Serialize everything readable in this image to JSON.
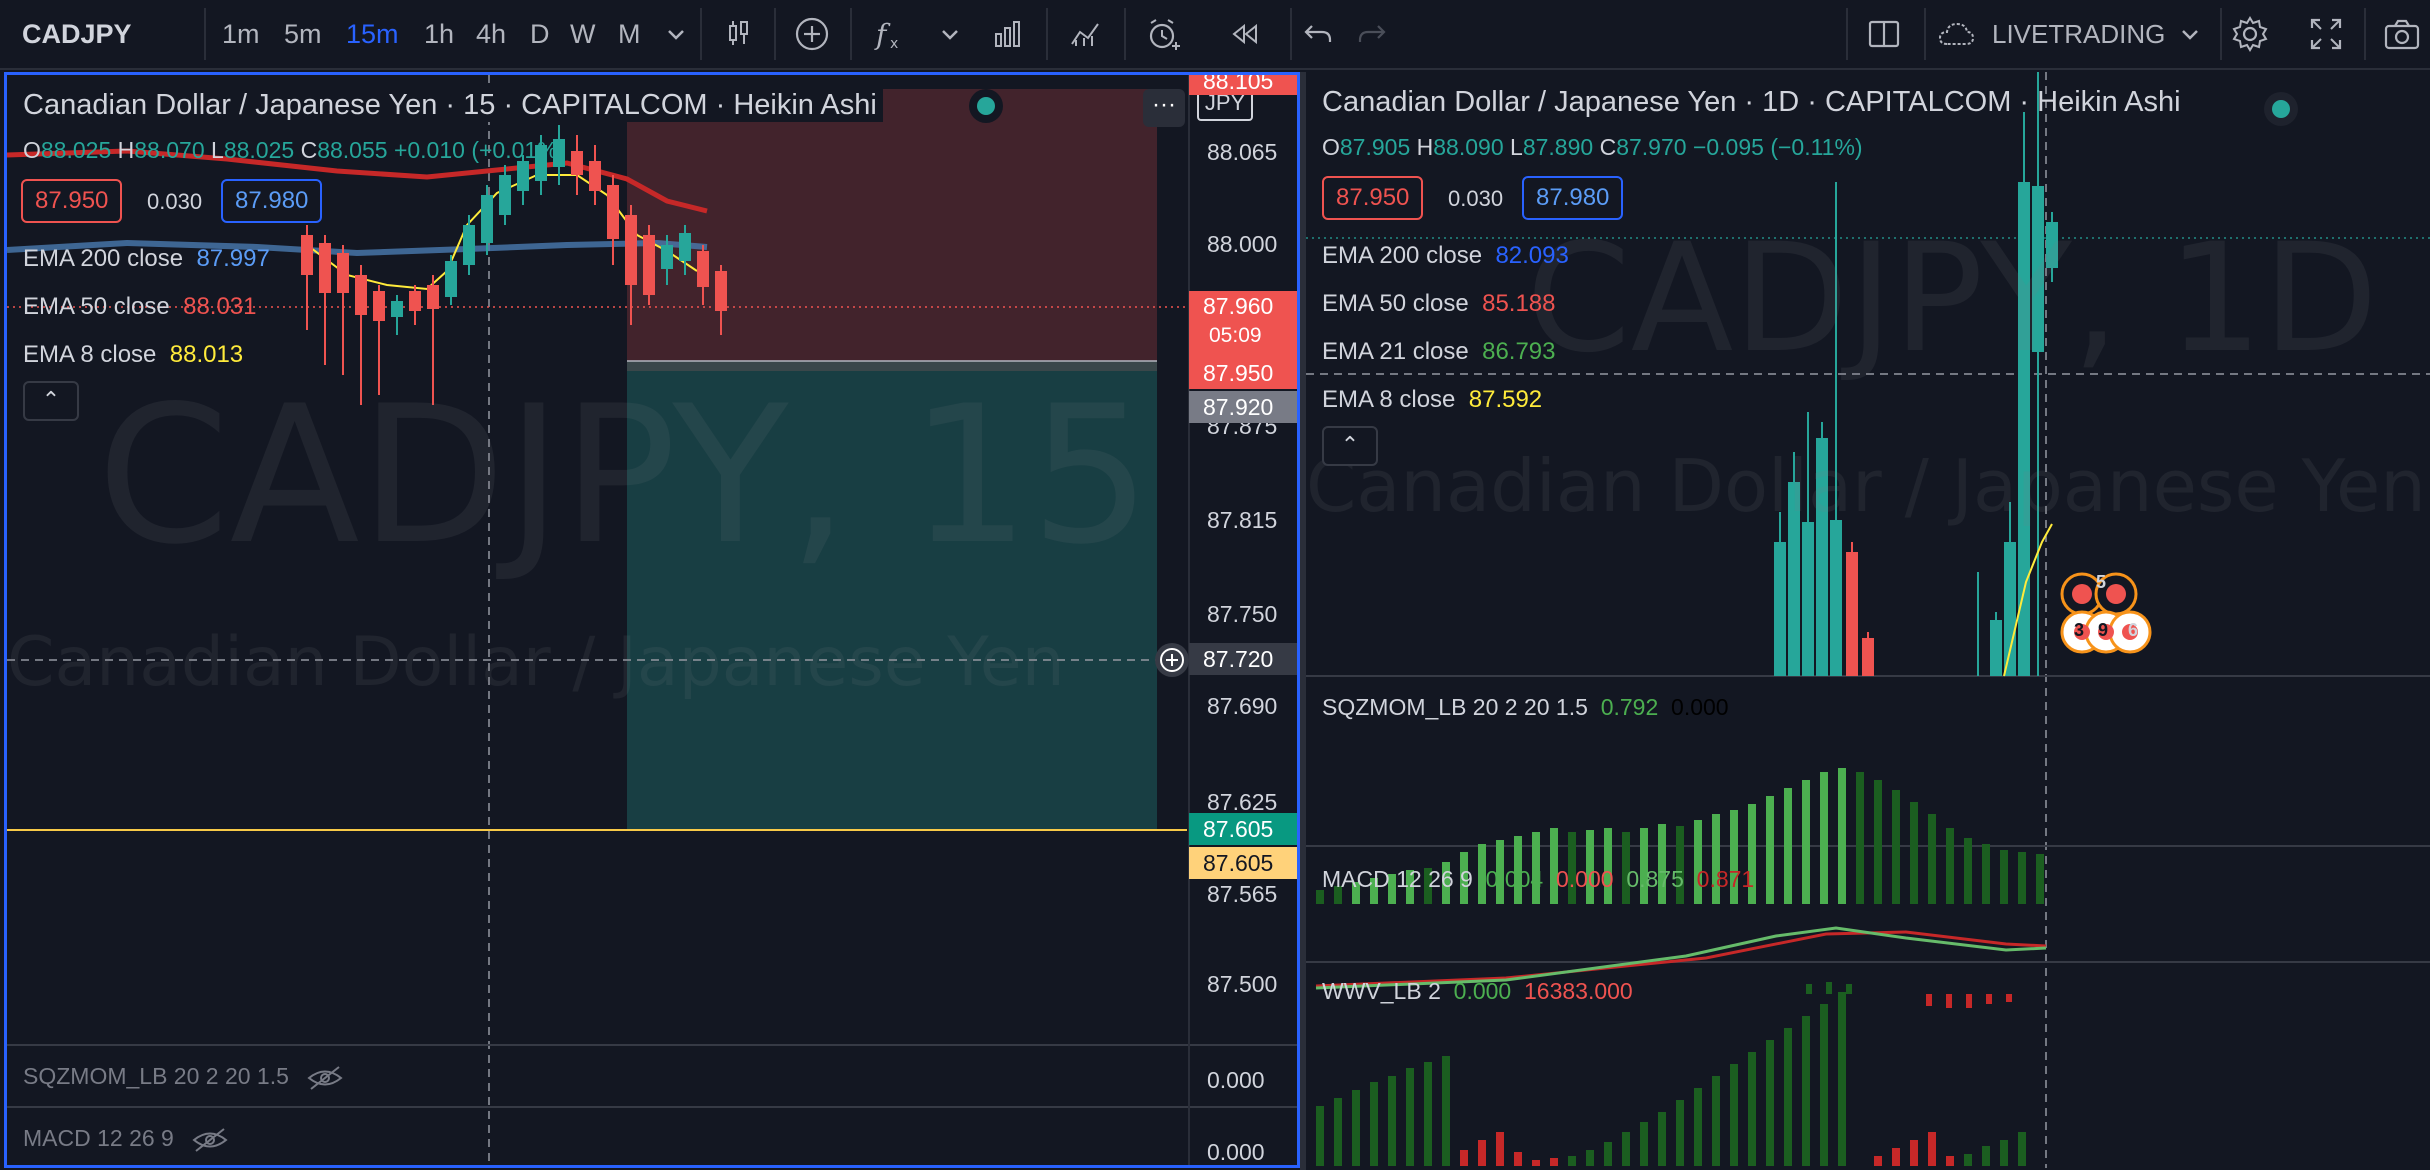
{
  "toolbar": {
    "symbol": "CADJPY",
    "intervals": [
      "1m",
      "5m",
      "15m",
      "1h",
      "4h",
      "D",
      "W",
      "M"
    ],
    "active_interval": "15m",
    "livetrading_label": "LIVETRADING"
  },
  "left_chart": {
    "title": "Canadian Dollar / Japanese Yen · 15 · CAPITALCOM · Heikin Ashi",
    "ohlc": {
      "o_label": "O",
      "o": "88.025",
      "h_label": "H",
      "h": "88.070",
      "l_label": "L",
      "l": "88.025",
      "c_label": "C",
      "c": "88.055",
      "change": "+0.010 (+0.01%)"
    },
    "sell_price": "87.950",
    "spread": "0.030",
    "buy_price": "87.980",
    "indicators": [
      {
        "label": "EMA 200 close",
        "value": "87.997",
        "color": "#5b9cf6"
      },
      {
        "label": "EMA 50 close",
        "value": "88.031",
        "color": "#ef5350"
      },
      {
        "label": "EMA 8 close",
        "value": "88.013",
        "color": "#ffeb3b"
      }
    ],
    "watermark_big": "CADJPY, 15",
    "watermark_small": "Canadian Dollar / Japanese Yen",
    "currency_badge": "JPY",
    "more_label": "···",
    "collapse_label": "⌃",
    "axis_ticks": [
      "88.105",
      "88.065",
      "88.000",
      "87.875",
      "87.815",
      "87.750",
      "87.690",
      "87.625",
      "87.565",
      "87.500"
    ],
    "axis_tags": {
      "last_price": "87.960",
      "countdown": "05:09",
      "sell": "87.950",
      "gray": "87.920",
      "crosshair": "87.720",
      "green": "87.605",
      "yellow": "87.605"
    },
    "sub1": {
      "label": "SQZMOM_LB 20 2 20 1.5",
      "axis": "0.000"
    },
    "sub2": {
      "label": "MACD 12 26 9",
      "axis": "0.000"
    }
  },
  "right_chart": {
    "title": "Canadian Dollar / Japanese Yen · 1D · CAPITALCOM · Heikin Ashi",
    "ohlc": {
      "o_label": "O",
      "o": "87.905",
      "h_label": "H",
      "h": "88.090",
      "l_label": "L",
      "l": "87.890",
      "c_label": "C",
      "c": "87.970",
      "change": "−0.095 (−0.11%)"
    },
    "sell_price": "87.950",
    "spread": "0.030",
    "buy_price": "87.980",
    "indicators": [
      {
        "label": "EMA 200 close",
        "value": "82.093",
        "color": "#2962ff"
      },
      {
        "label": "EMA 50 close",
        "value": "85.188",
        "color": "#ef5350"
      },
      {
        "label": "EMA 21 close",
        "value": "86.793",
        "color": "#4caf50"
      },
      {
        "label": "EMA 8 close",
        "value": "87.592",
        "color": "#ffeb3b"
      }
    ],
    "watermark_big": "CADJPY, 1D",
    "watermark_small": "Canadian Dollar / Japanese Yen",
    "collapse_label": "⌃",
    "event_badges": [
      "5",
      "3",
      "9",
      "6"
    ],
    "sqzmom": {
      "label": "SQZMOM_LB 20 2 20 1.5",
      "v1": "0.792",
      "v2": "0.000"
    },
    "macd": {
      "label": "MACD 12 26 9",
      "v1": "0.004",
      "v2": "0.000",
      "v3": "0.875",
      "v4": "0.871"
    },
    "wwv": {
      "label": "WWV_LB 2",
      "v1": "0.000",
      "v2": "16383.000"
    }
  },
  "colors": {
    "up": "#26a69a",
    "down": "#ef5350",
    "accent": "#2962ff",
    "ema_yellow": "#ffeb3b",
    "background": "#131722"
  }
}
